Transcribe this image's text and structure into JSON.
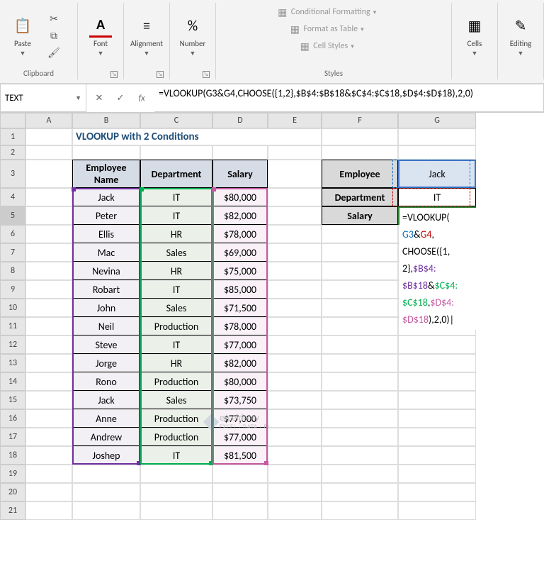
{
  "ribbon": {
    "groups": {
      "clipboard": {
        "label": "Clipboard",
        "paste": "Paste"
      },
      "font": {
        "label": "Font"
      },
      "alignment": {
        "label": "Alignment"
      },
      "number": {
        "label": "Number"
      },
      "styles": {
        "label": "Styles",
        "conditional": "Conditional Formatting",
        "table": "Format as Table",
        "cellstyles": "Cell Styles"
      },
      "cells": {
        "label": "Cells"
      },
      "editing": {
        "label": "Editing"
      }
    }
  },
  "namebox": "TEXT",
  "formula": "=VLOOKUP(G3&G4,CHOOSE({1,2},$B$4:$B$18&$C$4:$C$18,$D$4:$D$18),2,0)",
  "columns": [
    "A",
    "B",
    "C",
    "D",
    "E",
    "F",
    "G"
  ],
  "title": "VLOOKUP with 2 Conditions",
  "main_table": {
    "headers": {
      "name": "Employee\nName",
      "dept": "Department",
      "salary": "Salary"
    },
    "rows": [
      {
        "name": "Jack",
        "dept": "IT",
        "salary": "$80,000"
      },
      {
        "name": "Peter",
        "dept": "IT",
        "salary": "$82,000"
      },
      {
        "name": "Ellis",
        "dept": "HR",
        "salary": "$78,000"
      },
      {
        "name": "Mac",
        "dept": "Sales",
        "salary": "$69,000"
      },
      {
        "name": "Nevina",
        "dept": "HR",
        "salary": "$75,000"
      },
      {
        "name": "Robart",
        "dept": "IT",
        "salary": "$85,000"
      },
      {
        "name": "John",
        "dept": "Sales",
        "salary": "$71,500"
      },
      {
        "name": "Neil",
        "dept": "Production",
        "salary": "$78,000"
      },
      {
        "name": "Steve",
        "dept": "IT",
        "salary": "$77,000"
      },
      {
        "name": "Jorge",
        "dept": "HR",
        "salary": "$82,000"
      },
      {
        "name": "Rono",
        "dept": "Production",
        "salary": "$80,000"
      },
      {
        "name": "Jack",
        "dept": "Sales",
        "salary": "$73,750"
      },
      {
        "name": "Anne",
        "dept": "Production",
        "salary": "$77,000"
      },
      {
        "name": "Andrew",
        "dept": "Production",
        "salary": "$77,000"
      },
      {
        "name": "Joshep",
        "dept": "IT",
        "salary": "$81,500"
      }
    ]
  },
  "lookup": {
    "employee_label": "Employee",
    "employee_value": "Jack",
    "department_label": "Department",
    "department_value": "IT",
    "salary_label": "Salary"
  },
  "formula_tokens": {
    "l1a": "=VLOOKUP(",
    "l2a": "G3",
    "l2b": "&",
    "l2c": "G4",
    "l2d": ",",
    "l3": "CHOOSE({1,",
    "l4a": "2},",
    "l4b": "$B$4:",
    "l5a": "$B$18",
    "l5b": "&",
    "l5c": "$C$4:",
    "l6a": "$C$18",
    "l6b": ",",
    "l6c": "$D$4:",
    "l7a": "$D$18",
    "l7b": "),2,0)|"
  },
  "watermark": {
    "main": "exceldemy",
    "sub": "EXCEL · DATA · BI"
  }
}
